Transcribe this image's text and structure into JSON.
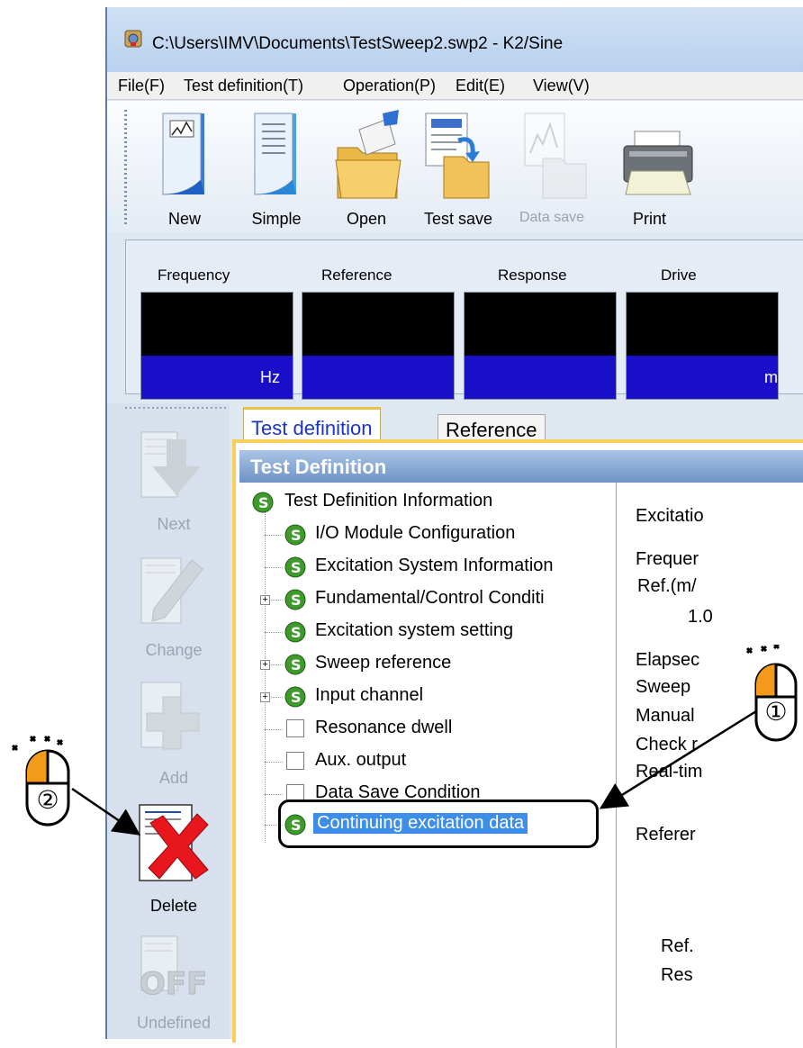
{
  "window": {
    "title": "C:\\Users\\IMV\\Documents\\TestSweep2.swp2 - K2/Sine"
  },
  "menu": [
    "File(F)",
    "Test definition(T)",
    "Operation(P)",
    "Edit(E)",
    "View(V)"
  ],
  "toolbar": [
    {
      "label": "New",
      "icon": "new-document-icon",
      "enabled": true
    },
    {
      "label": "Simple",
      "icon": "simple-document-icon",
      "enabled": true
    },
    {
      "label": "Open",
      "icon": "open-folder-icon",
      "enabled": true
    },
    {
      "label": "Test save",
      "icon": "test-save-icon",
      "enabled": true
    },
    {
      "label": "Data save",
      "icon": "data-save-icon",
      "enabled": false
    },
    {
      "label": "Print",
      "icon": "printer-icon",
      "enabled": true
    }
  ],
  "meters": [
    {
      "label": "Frequency",
      "unit": "Hz"
    },
    {
      "label": "Reference",
      "unit": ""
    },
    {
      "label": "Response",
      "unit": ""
    },
    {
      "label": "Drive",
      "unit": "m"
    }
  ],
  "actions": [
    {
      "label": "Next",
      "enabled": false
    },
    {
      "label": "Change",
      "enabled": false
    },
    {
      "label": "Add",
      "enabled": false
    },
    {
      "label": "Delete",
      "enabled": true
    },
    {
      "label": "Undefined",
      "enabled": false
    }
  ],
  "tabs": {
    "active": "Test definition",
    "inactive": "Reference"
  },
  "panel_title": "Test Definition",
  "tree": {
    "root": "Test Definition Information",
    "items": [
      {
        "label": "I/O Module Configuration",
        "icon": "s",
        "expandable": false
      },
      {
        "label": "Excitation System Information",
        "icon": "s",
        "expandable": false
      },
      {
        "label": "Fundamental/Control Conditi",
        "icon": "s",
        "expandable": true
      },
      {
        "label": "Excitation system setting",
        "icon": "s",
        "expandable": false
      },
      {
        "label": "Sweep reference",
        "icon": "s",
        "expandable": true
      },
      {
        "label": "Input channel",
        "icon": "s",
        "expandable": true
      },
      {
        "label": "Resonance dwell",
        "icon": "checkbox",
        "expandable": false
      },
      {
        "label": "Aux. output",
        "icon": "checkbox",
        "expandable": false
      },
      {
        "label": "Data Save Condition",
        "icon": "checkbox",
        "expandable": false
      },
      {
        "label": "Continuing excitation data",
        "icon": "s",
        "expandable": false,
        "selected": true
      }
    ]
  },
  "detail": [
    "Excitatio",
    "Frequer",
    "Ref.(m/",
    "1.0",
    "Elapsec",
    "Sweep",
    "Manual",
    "Check r",
    "Real-tim",
    "Referer",
    "Ref.",
    "Res"
  ],
  "annotations": {
    "step1": "①",
    "step2": "②"
  },
  "colors": {
    "accent": "#1a0fc8",
    "selection": "#3d8ee9",
    "tab_border": "#f5cf5a",
    "mouse_button": "#f39a1a"
  }
}
